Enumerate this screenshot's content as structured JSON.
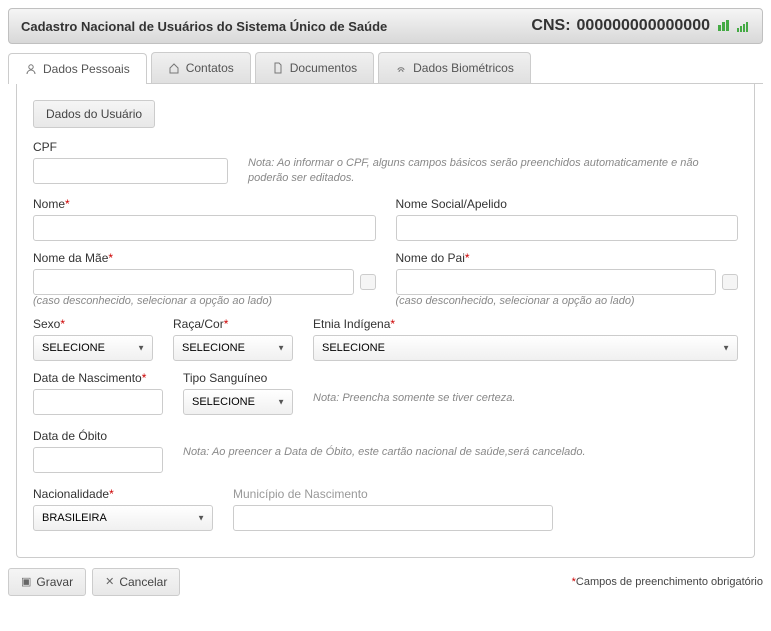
{
  "header": {
    "title": "Cadastro Nacional de Usuários do Sistema Único de Saúde",
    "cns_label": "CNS:",
    "cns_value": "000000000000000"
  },
  "tabs": {
    "dados_pessoais": "Dados Pessoais",
    "contatos": "Contatos",
    "documentos": "Documentos",
    "dados_biometricos": "Dados Biométricos"
  },
  "section_button": "Dados do Usuário",
  "labels": {
    "cpf": "CPF",
    "cpf_note": "Nota: Ao informar o CPF, alguns campos básicos serão preenchidos automaticamente e não poderão ser editados.",
    "nome": "Nome",
    "nome_social": "Nome Social/Apelido",
    "nome_mae": "Nome da Mãe",
    "nome_pai": "Nome do Pai",
    "unknown_hint": "(caso desconhecido, selecionar a opção ao lado)",
    "sexo": "Sexo",
    "raca_cor": "Raça/Cor",
    "etnia_indigena": "Etnia Indígena",
    "data_nascimento": "Data de Nascimento",
    "tipo_sanguineo": "Tipo Sanguíneo",
    "tipo_sanguineo_note": "Nota: Preencha somente se tiver certeza.",
    "data_obito": "Data de Óbito",
    "data_obito_note": "Nota: Ao preencer a Data de Óbito, este cartão nacional de saúde,será cancelado.",
    "nacionalidade": "Nacionalidade",
    "municipio_nascimento": "Município de Nascimento"
  },
  "select_values": {
    "placeholder": "SELECIONE",
    "nacionalidade": "BRASILEIRA"
  },
  "footer": {
    "gravar": "Gravar",
    "cancelar": "Cancelar",
    "required_note": "*Campos de preenchimento obrigatório"
  }
}
